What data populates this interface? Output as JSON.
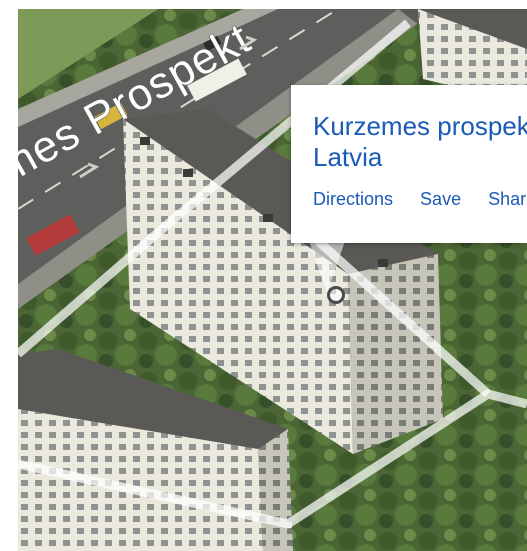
{
  "map": {
    "view": "aerial",
    "street_label": "mes Prospekt",
    "colors": {
      "foliage": "#4e6a36",
      "road": "#5d5f5c",
      "roof": "#5a5955",
      "facade": "#e9e6dc",
      "link_blue": "#1a5ab8",
      "outline": "#ffffff"
    }
  },
  "info_card": {
    "title": "Kurzemes prospekts",
    "subtitle": "Latvia",
    "actions": [
      "Directions",
      "Save",
      "Share"
    ]
  },
  "pin": {
    "icon": "location-pin-icon"
  }
}
